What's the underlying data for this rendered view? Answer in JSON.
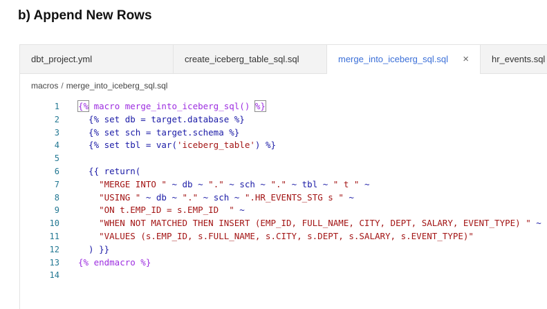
{
  "heading": "b) Append New Rows",
  "tabs": [
    {
      "label": "dbt_project.yml"
    },
    {
      "label": "create_iceberg_table_sql.sql"
    },
    {
      "label": "merge_into_iceberg_sql.sql",
      "close": "×"
    },
    {
      "label": "hr_events.sql"
    }
  ],
  "breadcrumb": {
    "folder": "macros",
    "separator": "/",
    "file": "merge_into_iceberg_sql.sql"
  },
  "code": {
    "line_numbers": [
      "1",
      "2",
      "3",
      "4",
      "5",
      "6",
      "7",
      "8",
      "9",
      "10",
      "11",
      "12",
      "13",
      "14"
    ],
    "lines": [
      [
        {
          "t": "{%",
          "c": "purple",
          "box": true
        },
        {
          "t": " macro merge_into_iceberg_sql() ",
          "c": "purple"
        },
        {
          "t": "%}",
          "c": "purple",
          "box": true
        }
      ],
      [
        {
          "t": "  {% set db = target.database %}",
          "c": "blue"
        }
      ],
      [
        {
          "t": "  {% set sch = target.schema %}",
          "c": "blue"
        }
      ],
      [
        {
          "t": "  {% set tbl = var(",
          "c": "blue"
        },
        {
          "t": "'iceberg_table'",
          "c": "red"
        },
        {
          "t": ") %}",
          "c": "blue"
        }
      ],
      [
        {
          "t": "",
          "c": "black"
        }
      ],
      [
        {
          "t": "  {{ return(",
          "c": "blue"
        }
      ],
      [
        {
          "t": "    ",
          "c": "black"
        },
        {
          "t": "\"MERGE INTO \"",
          "c": "red"
        },
        {
          "t": " ~ db ~ ",
          "c": "blue"
        },
        {
          "t": "\".\"",
          "c": "red"
        },
        {
          "t": " ~ sch ~ ",
          "c": "blue"
        },
        {
          "t": "\".\"",
          "c": "red"
        },
        {
          "t": " ~ tbl ~ ",
          "c": "blue"
        },
        {
          "t": "\" t \"",
          "c": "red"
        },
        {
          "t": " ~",
          "c": "blue"
        }
      ],
      [
        {
          "t": "    ",
          "c": "black"
        },
        {
          "t": "\"USING \"",
          "c": "red"
        },
        {
          "t": " ~ db ~ ",
          "c": "blue"
        },
        {
          "t": "\".\"",
          "c": "red"
        },
        {
          "t": " ~ sch ~ ",
          "c": "blue"
        },
        {
          "t": "\".HR_EVENTS_STG s \"",
          "c": "red"
        },
        {
          "t": " ~",
          "c": "blue"
        }
      ],
      [
        {
          "t": "    ",
          "c": "black"
        },
        {
          "t": "\"ON t.EMP_ID = s.EMP_ID  \"",
          "c": "red"
        },
        {
          "t": " ~",
          "c": "blue"
        }
      ],
      [
        {
          "t": "    ",
          "c": "black"
        },
        {
          "t": "\"WHEN NOT MATCHED THEN INSERT (EMP_ID, FULL_NAME, CITY, DEPT, SALARY, EVENT_TYPE) \"",
          "c": "red"
        },
        {
          "t": " ~",
          "c": "blue"
        }
      ],
      [
        {
          "t": "    ",
          "c": "black"
        },
        {
          "t": "\"VALUES (s.EMP_ID, s.FULL_NAME, s.CITY, s.DEPT, s.SALARY, s.EVENT_TYPE)\"",
          "c": "red"
        }
      ],
      [
        {
          "t": "  ) }}",
          "c": "blue"
        }
      ],
      [
        {
          "t": "{% endmacro %}",
          "c": "purple"
        }
      ],
      [
        {
          "t": "",
          "c": "black"
        }
      ]
    ]
  }
}
